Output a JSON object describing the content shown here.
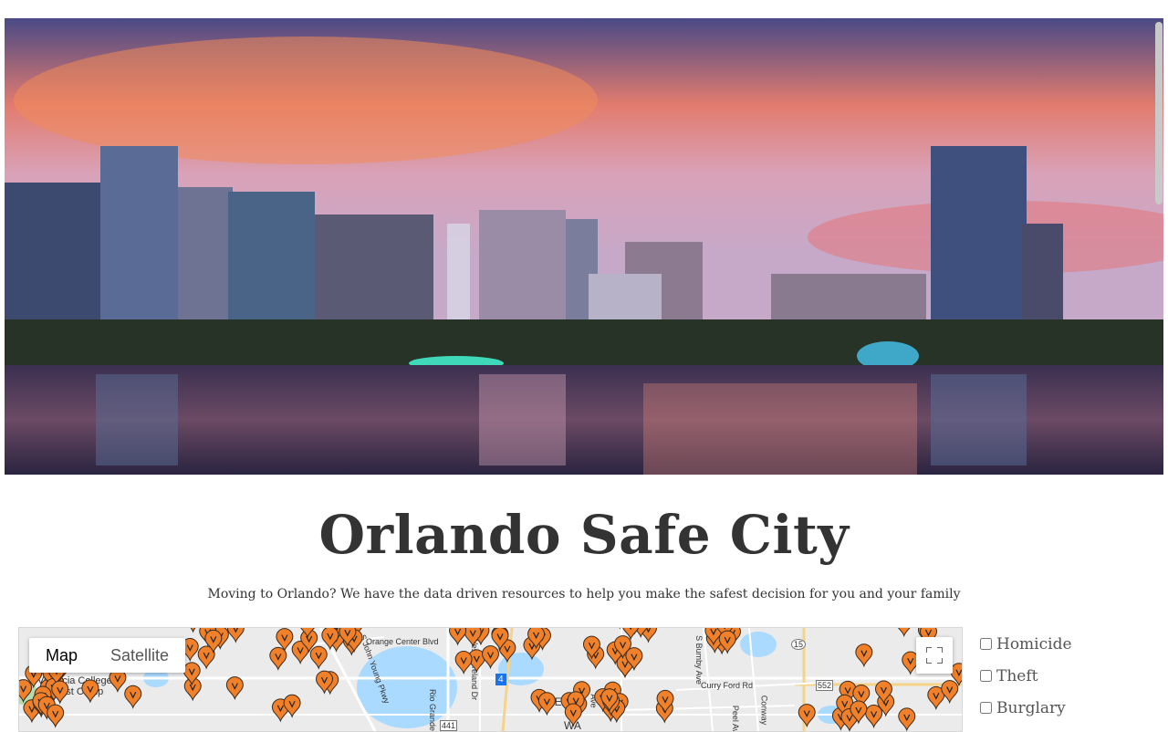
{
  "page": {
    "title": "Orlando Safe City",
    "subtitle": "Moving to Orlando? We have the data driven resources to help you make the safest decision for you and your family"
  },
  "map": {
    "tabs": [
      {
        "label": "Map",
        "active": true
      },
      {
        "label": "Satellite",
        "active": false
      }
    ],
    "labels": {
      "valencia": "Valencia College",
      "west_camp": "West Camp",
      "orange_center": "Orange Center Blvd",
      "john_young": "S John Young Pkwy",
      "rio_grande": "Rio Grande",
      "westmoreland": "S Westmoreland Dr",
      "lse": "LSE",
      "wa": "WA",
      "mills_ave": "Ave",
      "barnett": "S Bumby Ave",
      "curry_ford": "Curry Ford Rd",
      "conway": "Conway",
      "peel": "Peel Av",
      "hwy_15": "15",
      "hwy_552": "552",
      "hwy_441": "441",
      "hwy_4": "4"
    },
    "marker_color": "#f0802a"
  },
  "filters": [
    {
      "label": "Homicide",
      "checked": false
    },
    {
      "label": "Theft",
      "checked": false
    },
    {
      "label": "Burglary",
      "checked": false
    }
  ]
}
